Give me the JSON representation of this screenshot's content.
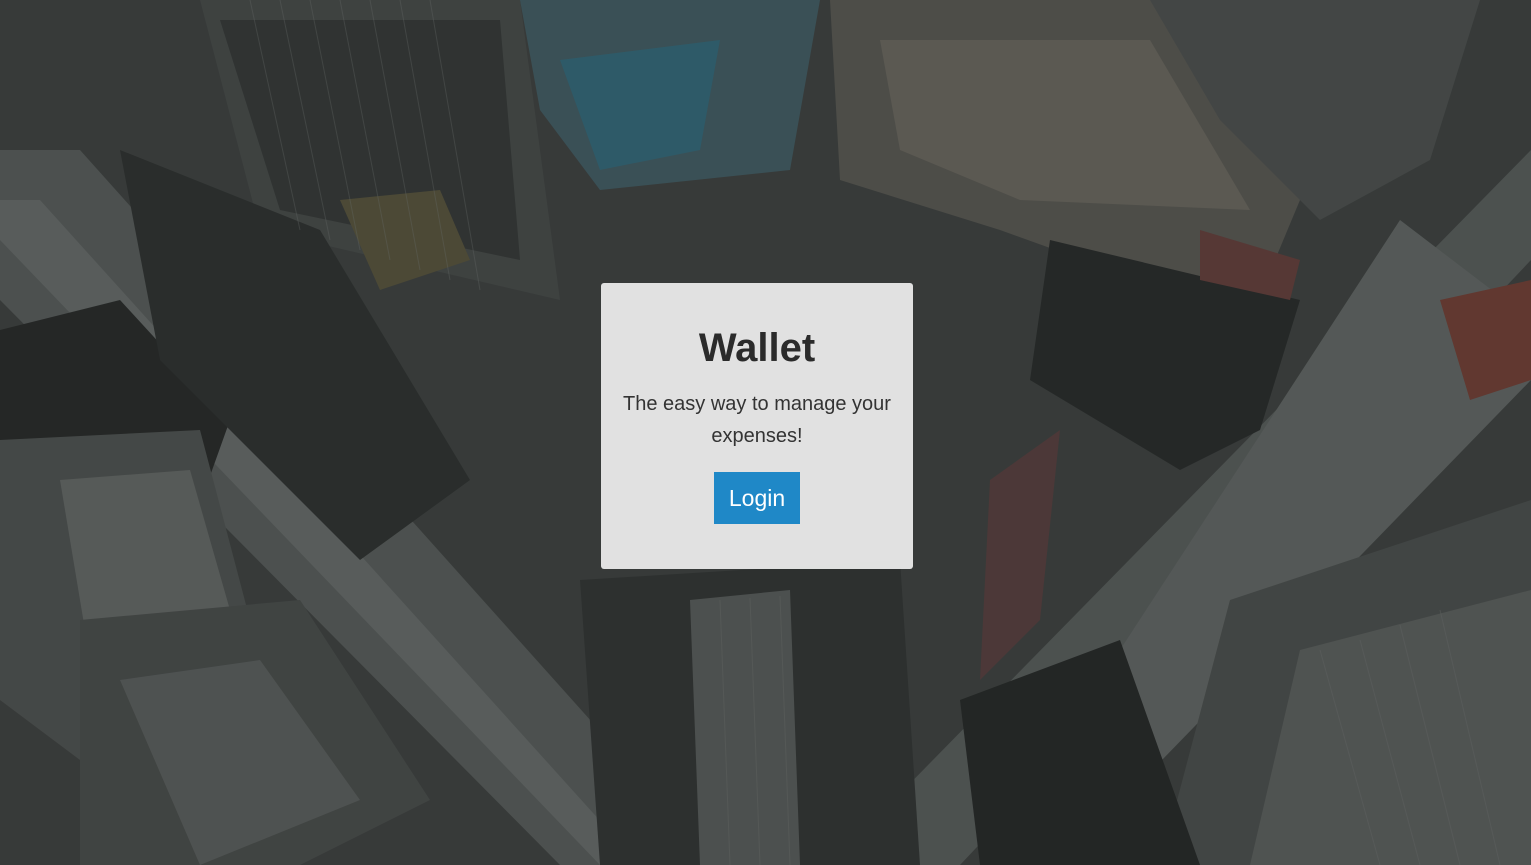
{
  "card": {
    "title": "Wallet",
    "subtitle": "The easy way to manage your expenses!",
    "login_label": "Login"
  },
  "colors": {
    "accent": "#1f88c7",
    "card_background": "#ececec",
    "title_text": "#2b2b2b"
  },
  "background": {
    "description_icon": "city-aerial-photo"
  }
}
